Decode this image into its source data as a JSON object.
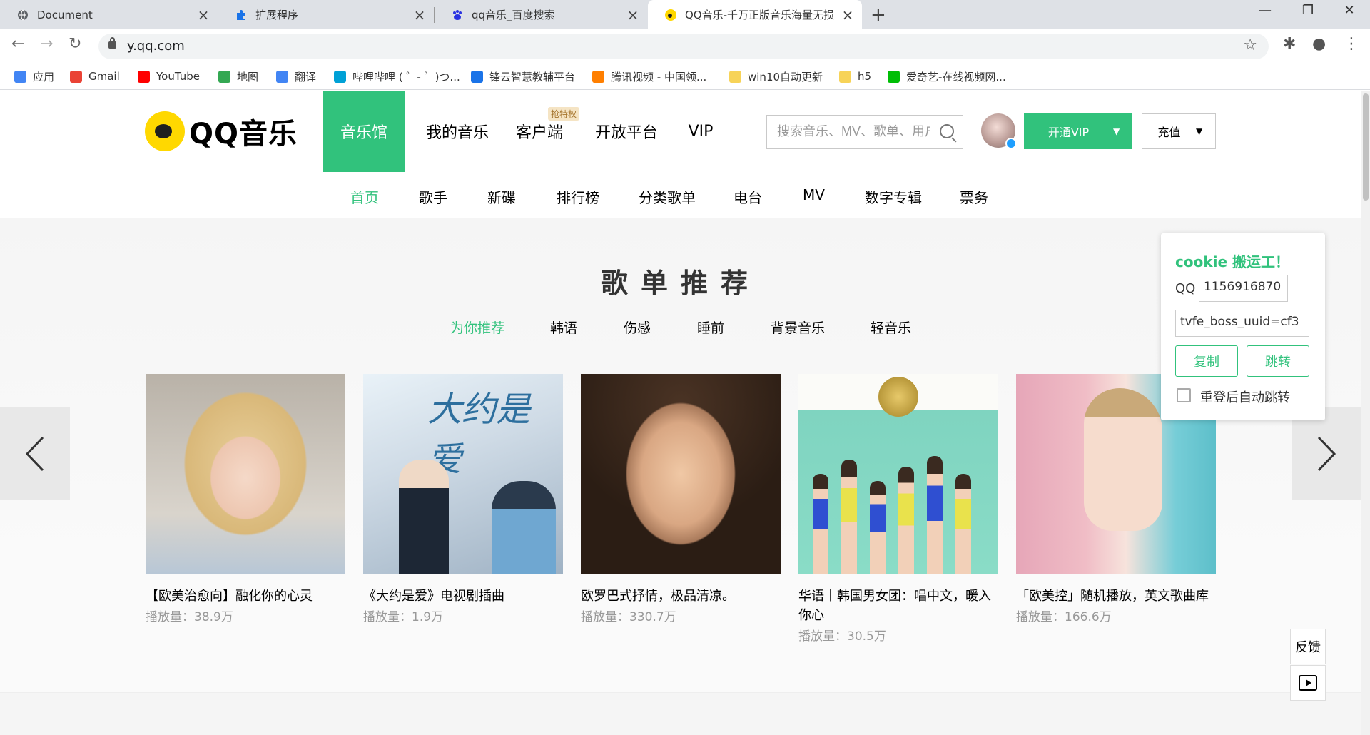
{
  "browser": {
    "tabs": [
      {
        "title": "Document"
      },
      {
        "title": "扩展程序"
      },
      {
        "title": "qq音乐_百度搜索"
      },
      {
        "title": "QQ音乐-千万正版音乐海量无损"
      }
    ],
    "url": "y.qq.com",
    "bookmarks": [
      {
        "label": "应用",
        "color": "#4285f4"
      },
      {
        "label": "Gmail",
        "color": "#ea4335"
      },
      {
        "label": "YouTube",
        "color": "#ff0000"
      },
      {
        "label": "地图",
        "color": "#34a853"
      },
      {
        "label": "翻译",
        "color": "#4285f4"
      },
      {
        "label": "哔哩哔哩 ( ゜- ゜)つ...",
        "color": "#00a1d6"
      },
      {
        "label": "锋云智慧教辅平台",
        "color": "#1a73e8"
      },
      {
        "label": "腾讯视频 - 中国领...",
        "color": "#ff7f00"
      },
      {
        "label": "win10自动更新",
        "color": "#f7d358"
      },
      {
        "label": "h5",
        "color": "#f7d358"
      },
      {
        "label": "爱奇艺-在线视频网...",
        "color": "#00be06"
      }
    ]
  },
  "site": {
    "logo_text": "QQ音乐",
    "nav": [
      "音乐馆",
      "我的音乐",
      "客户端",
      "开放平台",
      "VIP"
    ],
    "client_badge": "抢特权",
    "search_placeholder": "搜索音乐、MV、歌单、用户",
    "vip_button": "开通VIP",
    "recharge_button": "充值",
    "subnav": [
      "首页",
      "歌手",
      "新碟",
      "排行榜",
      "分类歌单",
      "电台",
      "MV",
      "数字专辑",
      "票务"
    ],
    "accent": "#31c27c"
  },
  "playlists": {
    "title": "歌单推荐",
    "categories": [
      "为你推荐",
      "韩语",
      "伤感",
      "睡前",
      "背景音乐",
      "轻音乐"
    ],
    "items": [
      {
        "name": "【欧美治愈向】融化你的心灵",
        "plays": "播放量：38.9万"
      },
      {
        "name": "《大约是爱》电视剧插曲",
        "plays": "播放量：1.9万"
      },
      {
        "name": "欧罗巴式抒情，极品清凉。",
        "plays": "播放量：330.7万"
      },
      {
        "name": "华语丨韩国男女团：唱中文，暖入你心",
        "plays": "播放量：30.5万"
      },
      {
        "name": "「欧美控」随机播放，英文歌曲库",
        "plays": "播放量：166.6万"
      }
    ],
    "cover2_text": "大约是爱"
  },
  "cookie_widget": {
    "title": "cookie 搬运工！",
    "qq_label": "QQ",
    "qq_value": "1156916870",
    "cookie_value": "tvfe_boss_uuid=cf3",
    "copy_button": "复制",
    "jump_button": "跳转",
    "auto_jump_label": "重登后自动跳转"
  },
  "side_tools": {
    "feedback": "反馈"
  }
}
